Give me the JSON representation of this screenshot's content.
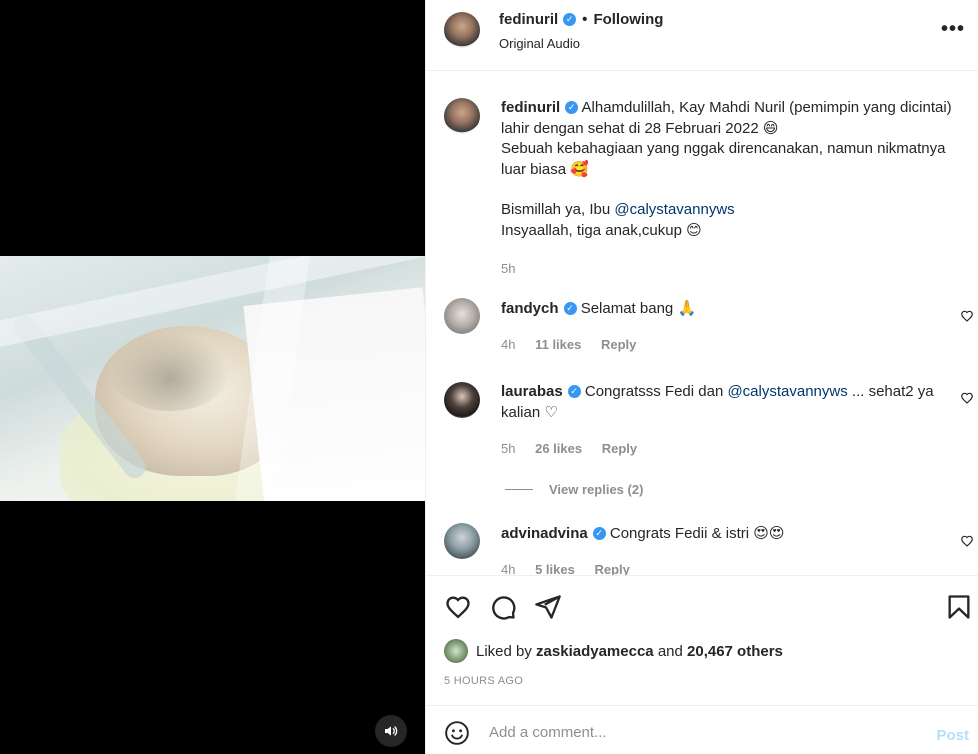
{
  "header": {
    "username": "fedinuril",
    "verified_icon": "verified-badge-icon",
    "separator": "•",
    "follow_status": "Following",
    "subtitle": "Original Audio",
    "more_icon": "more-options-icon"
  },
  "caption": {
    "username": "fedinuril",
    "text_1": "Alhamdulillah, Kay Mahdi Nuril (pemimpin yang dicintai) lahir dengan sehat di 28 Februari 2022",
    "emoji_1": "😄",
    "text_2": "Sebuah kebahagiaan yang nggak direncanakan, namun nikmatnya luar biasa",
    "emoji_2": "🥰",
    "text_3": "Bismillah ya, Ibu",
    "mention": "@calystavannyws",
    "text_4": "Insyaallah, tiga anak,cukup",
    "emoji_4": "😊",
    "time": "5h"
  },
  "comments": [
    {
      "username": "fandych",
      "text": "Selamat bang",
      "emoji": "🙏",
      "time": "4h",
      "likes": "11 likes",
      "reply": "Reply"
    },
    {
      "username": "laurabas",
      "text_before": "Congratsss Fedi dan",
      "mention": "@calystavannyws",
      "text_after": "... sehat2 ya kalian",
      "emoji": "♡",
      "time": "5h",
      "likes": "26 likes",
      "reply": "Reply",
      "view_replies": "View replies (2)"
    },
    {
      "username": "advinadvina",
      "text": "Congrats Fedii & istri",
      "emoji": "😍😍",
      "time": "4h",
      "likes": "5 likes",
      "reply": "Reply"
    }
  ],
  "actions": {
    "icons": [
      "heart-icon",
      "comment-icon",
      "share-icon",
      "bookmark-icon"
    ],
    "liked_by_prefix": "Liked by",
    "liked_by_user": "zaskiadyamecca",
    "liked_and": "and",
    "liked_others": "20,467 others",
    "time_ago": "5 HOURS AGO"
  },
  "add_comment": {
    "placeholder": "Add a comment...",
    "post_label": "Post"
  },
  "media": {
    "audio_icon": "speaker-icon"
  }
}
